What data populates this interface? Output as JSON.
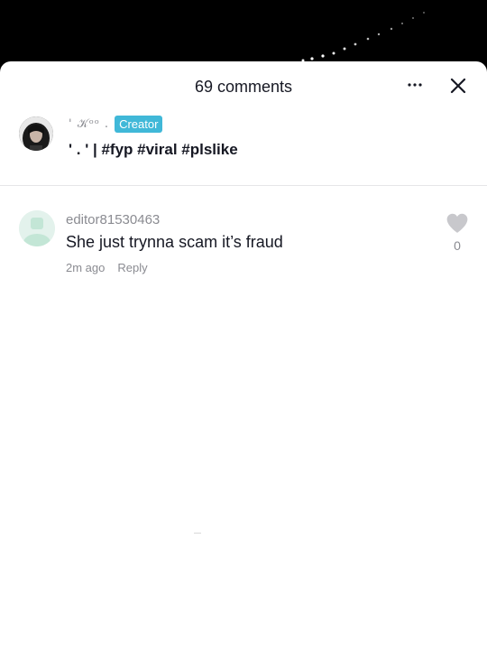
{
  "header": {
    "title": "69 comments",
    "more_icon": "more-horizontal-icon",
    "close_icon": "close-icon"
  },
  "caption": {
    "author_name": "' 𝒦ᵒᵒ .",
    "badge": "Creator",
    "text": "' . ' | #fyp #viral #plslike"
  },
  "comments": [
    {
      "username": "editor81530463",
      "text": "She just trynna scam it’s fraud",
      "time": "2m ago",
      "reply_label": "Reply",
      "like_count": "0",
      "like_icon": "heart-icon"
    }
  ],
  "colors": {
    "badge": "#40b8d8",
    "text_primary": "#161823",
    "text_secondary": "#8a8b91",
    "avatar_placeholder": "#e3f2ec"
  }
}
